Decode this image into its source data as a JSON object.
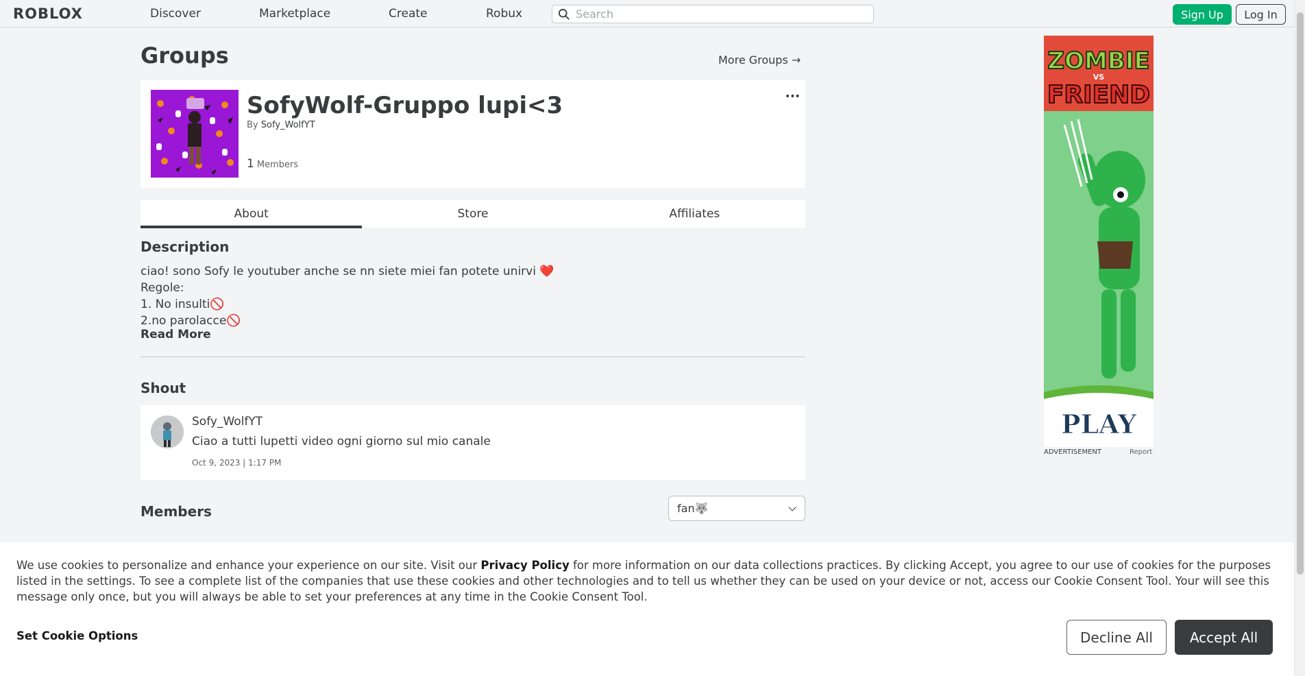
{
  "nav": {
    "logo": "ROBLOX",
    "links": [
      "Discover",
      "Marketplace",
      "Create",
      "Robux"
    ],
    "search_placeholder": "Search",
    "signup": "Sign Up",
    "login": "Log In"
  },
  "page": {
    "title": "Groups",
    "more_groups": "More Groups →"
  },
  "group": {
    "name": "SofyWolf-Gruppo lupi<3",
    "by_prefix": "By",
    "owner": "Sofy_WolfYT",
    "members_count": "1",
    "members_label": "Members",
    "more_icon": "•••"
  },
  "tabs": [
    {
      "label": "About",
      "active": true
    },
    {
      "label": "Store",
      "active": false
    },
    {
      "label": "Affiliates",
      "active": false
    }
  ],
  "description": {
    "heading": "Description",
    "lines": [
      "ciao! sono Sofy le youtuber anche se nn siete miei fan potete unirvi ❤️",
      "Regole:",
      "1. No insulti🚫",
      "2.no parolacce🚫"
    ],
    "read_more": "Read More"
  },
  "shout": {
    "heading": "Shout",
    "user": "Sofy_WolfYT",
    "text": "Ciao a tutti lupetti video ogni giorno sul mio canale",
    "date": "Oct 9, 2023 | 1:17 PM"
  },
  "members": {
    "heading": "Members",
    "role_selected": "fan🐺"
  },
  "ad": {
    "label": "ADVERTISEMENT",
    "report": "Report",
    "title_top": "ZOMBIE",
    "title_vs": "VS",
    "title_bottom": "FRIEND",
    "play": "PLAY"
  },
  "cookie": {
    "text_1": "We use cookies to personalize and enhance your experience on our site. Visit our ",
    "policy_link": "Privacy Policy",
    "text_2": " for more information on our data collections practices. By clicking Accept, you agree to our use of cookies for the purposes listed in the settings. To see a complete list of the companies that use these cookies and other technologies and to tell us whether they can be used on your device or not, access our Cookie Consent Tool. Your will see this message only once, but you will always be able to set your preferences at any time in the Cookie Consent Tool.",
    "set_options": "Set Cookie Options",
    "decline": "Decline All",
    "accept": "Accept All"
  },
  "colors": {
    "signup_green": "#00b06f",
    "accept_dark": "#393b3d",
    "page_bg": "#f2f4f5",
    "group_thumb_purple": "#9b17d6"
  }
}
